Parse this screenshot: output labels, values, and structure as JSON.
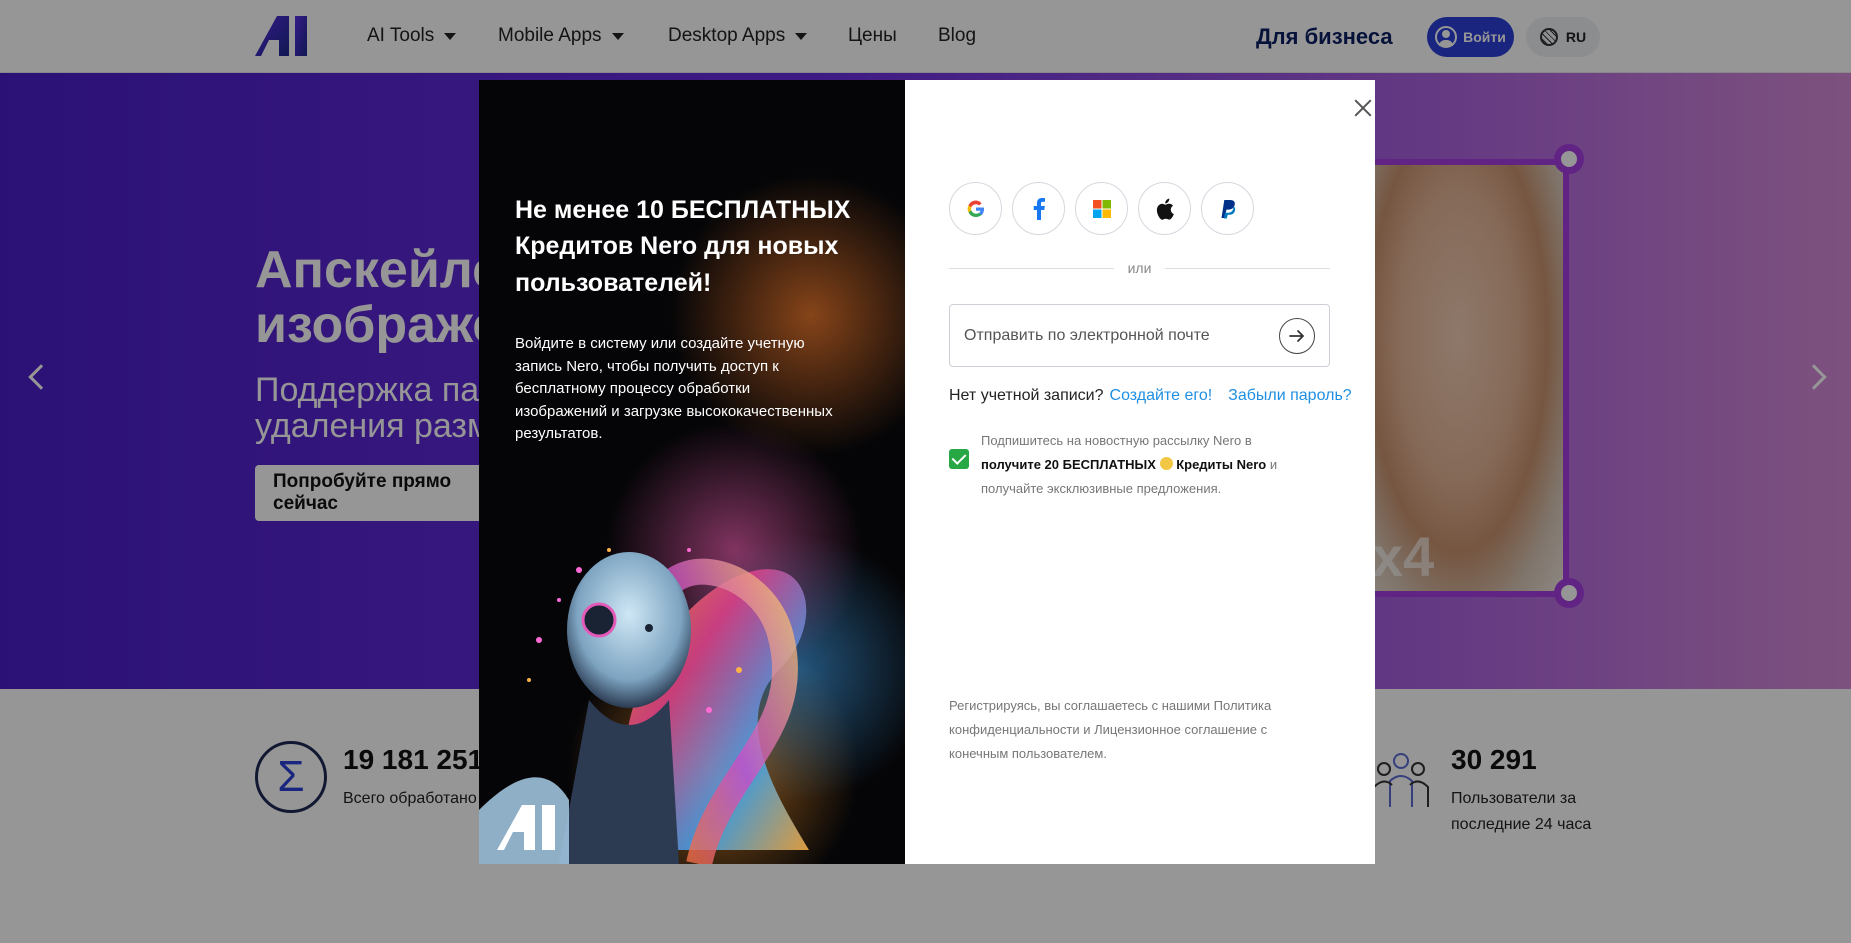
{
  "nav": {
    "items": [
      "AI Tools",
      "Mobile Apps",
      "Desktop Apps",
      "Цены",
      "Blog"
    ],
    "business": "Для бизнеса",
    "login": "Войти",
    "lang": "RU"
  },
  "hero": {
    "title_line1": "Апскейлер",
    "title_line2": "изображений",
    "sub_line1": "Поддержка пакетной",
    "sub_line2": "удаления размытости",
    "cta": "Попробуйте прямо сейчас",
    "photo_label": "x4"
  },
  "stats": {
    "processed_value": "19 181 251",
    "processed_label": "Всего обработано",
    "users_value": "30 291",
    "users_label_line1": "Пользователи за",
    "users_label_line2": "последние 24 часа"
  },
  "modal": {
    "promo_title": "Не менее 10 БЕСПЛАТНЫХ Кредитов Nero для новых пользователей!",
    "promo_text": "Войдите в систему или создайте учетную запись Nero, чтобы получить доступ к бесплатному процессу обработки изображений и загрузке высококачественных результатов.",
    "socials": [
      "google-icon",
      "facebook-icon",
      "microsoft-icon",
      "apple-icon",
      "paypal-icon"
    ],
    "divider": "или",
    "email_placeholder": "Отправить по электронной почте",
    "no_account": "Нет учетной записи?",
    "create": "Создайте его!",
    "forgot": "Забыли пароль?",
    "newsletter_pre": "Подпишитесь на новостную рассылку Nero в",
    "newsletter_bold1": "получите 20 БЕСПЛАТНЫХ",
    "newsletter_bold2": "Кредиты Nero",
    "newsletter_mid": "и",
    "newsletter_post": "получайте эксклюзивные предложения.",
    "newsletter_checked": true,
    "legal": "Регистрируясь, вы соглашаетесь с нашими Политика конфиденциальности и Лицензионное соглашение с конечным пользователем."
  },
  "colors": {
    "brand": "#2b3fd6",
    "link": "#1f8fe3",
    "checkbox": "#28a745",
    "hero_accent": "#a63ee0"
  }
}
